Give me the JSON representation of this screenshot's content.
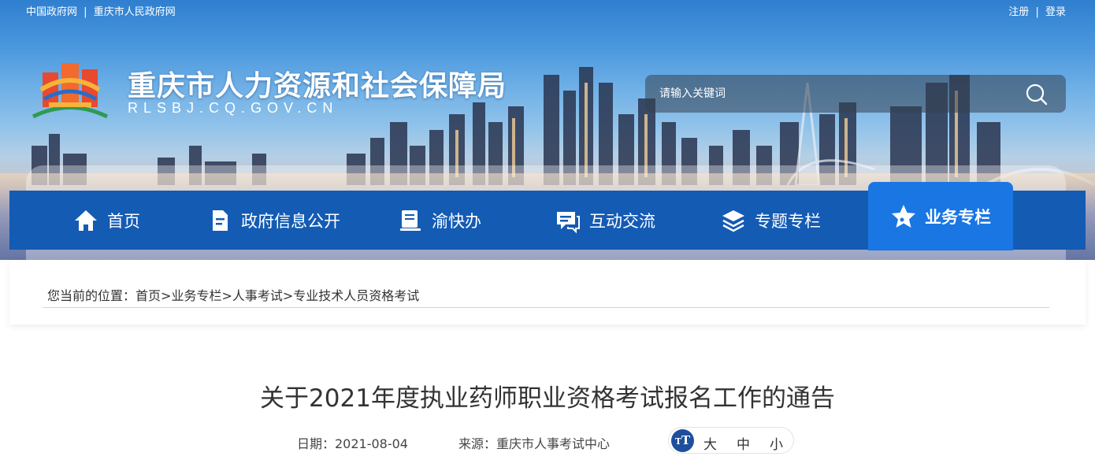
{
  "topbar": {
    "links": [
      "中国政府网",
      "重庆市人民政府网"
    ],
    "separator": "|",
    "register": "注册",
    "login": "登录"
  },
  "site": {
    "title": "重庆市人力资源和社会保障局",
    "domain": "RLSBJ.CQ.GOV.CN"
  },
  "search": {
    "placeholder": "请输入关键词",
    "icon": "search-icon"
  },
  "nav": {
    "items": [
      {
        "label": "首页",
        "icon": "home-icon"
      },
      {
        "label": "政府信息公开",
        "icon": "document-icon"
      },
      {
        "label": "渝快办",
        "icon": "book-icon"
      },
      {
        "label": "互动交流",
        "icon": "chat-icon"
      },
      {
        "label": "专题专栏",
        "icon": "layers-icon"
      },
      {
        "label": "业务专栏",
        "icon": "star-icon",
        "active": true
      }
    ]
  },
  "breadcrumb": {
    "prefix": "您当前的位置：",
    "items": [
      "首页",
      "业务专栏",
      "人事考试",
      "专业技术人员资格考试"
    ],
    "separator": ">"
  },
  "article": {
    "title": "关于2021年度执业药师职业资格考试报名工作的通告",
    "date_label": "日期：2021-08-04",
    "source_label": "来源：重庆市人事考试中心"
  },
  "font_size": {
    "badge": "T",
    "large": "大",
    "medium": "中",
    "small": "小"
  },
  "colors": {
    "nav_bg": "#145bb4",
    "nav_active": "#1976e3",
    "badge": "#1d4f9c"
  }
}
